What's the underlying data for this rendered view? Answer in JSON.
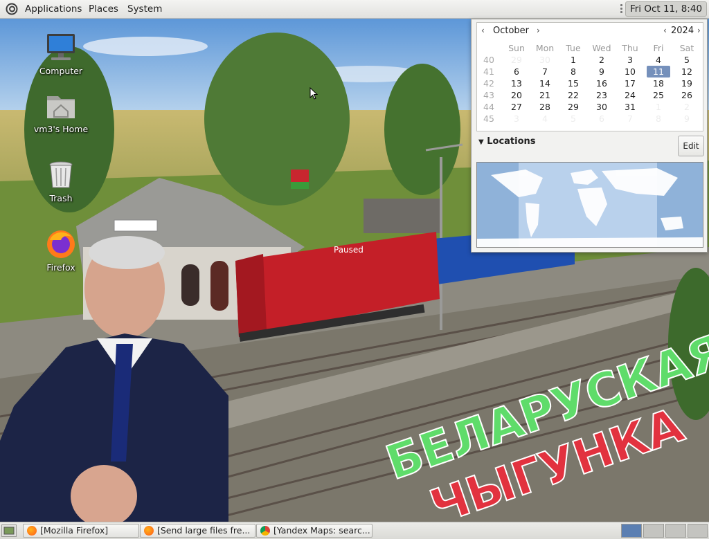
{
  "top_panel": {
    "menus": [
      "Applications",
      "Places",
      "System"
    ],
    "clock": "Fri Oct 11,  8:40 AM"
  },
  "desktop": {
    "icons": [
      {
        "label": "Computer",
        "icon": "computer-icon"
      },
      {
        "label": "vm3's Home",
        "icon": "home-folder-icon"
      },
      {
        "label": "Trash",
        "icon": "trash-icon"
      },
      {
        "label": "Firefox",
        "icon": "firefox-icon"
      }
    ],
    "scene_text": {
      "paused": "Paused",
      "line1": "БЕЛАРУСКАЯ",
      "line2": "ЧЫГУНКА",
      "line1_color": "#5fdc6a",
      "line2_color": "#e2323f"
    }
  },
  "calendar": {
    "month": "October",
    "year": "2024",
    "weekdays": [
      "Sun",
      "Mon",
      "Tue",
      "Wed",
      "Thu",
      "Fri",
      "Sat"
    ],
    "weeks": [
      {
        "week": "40",
        "days": [
          "29",
          "30",
          "1",
          "2",
          "3",
          "4",
          "5"
        ]
      },
      {
        "week": "41",
        "days": [
          "6",
          "7",
          "8",
          "9",
          "10",
          "11",
          "12"
        ]
      },
      {
        "week": "42",
        "days": [
          "13",
          "14",
          "15",
          "16",
          "17",
          "18",
          "19"
        ]
      },
      {
        "week": "43",
        "days": [
          "20",
          "21",
          "22",
          "23",
          "24",
          "25",
          "26"
        ]
      },
      {
        "week": "44",
        "days": [
          "27",
          "28",
          "29",
          "30",
          "31",
          "1",
          "2"
        ]
      },
      {
        "week": "45",
        "days": [
          "3",
          "4",
          "5",
          "6",
          "7",
          "8",
          "9"
        ]
      }
    ],
    "today": "11",
    "locations_label": "Locations",
    "edit_label": "Edit",
    "accent_color": "#7590bb"
  },
  "taskbar": {
    "tasks": [
      {
        "label": "[Mozilla Firefox]",
        "icon": "firefox-icon"
      },
      {
        "label": "[Send large files fre...",
        "icon": "firefox-icon"
      },
      {
        "label": "[Yandex Maps: searc...",
        "icon": "chrome-icon"
      }
    ],
    "workspace_count": 4,
    "active_workspace": 1
  }
}
